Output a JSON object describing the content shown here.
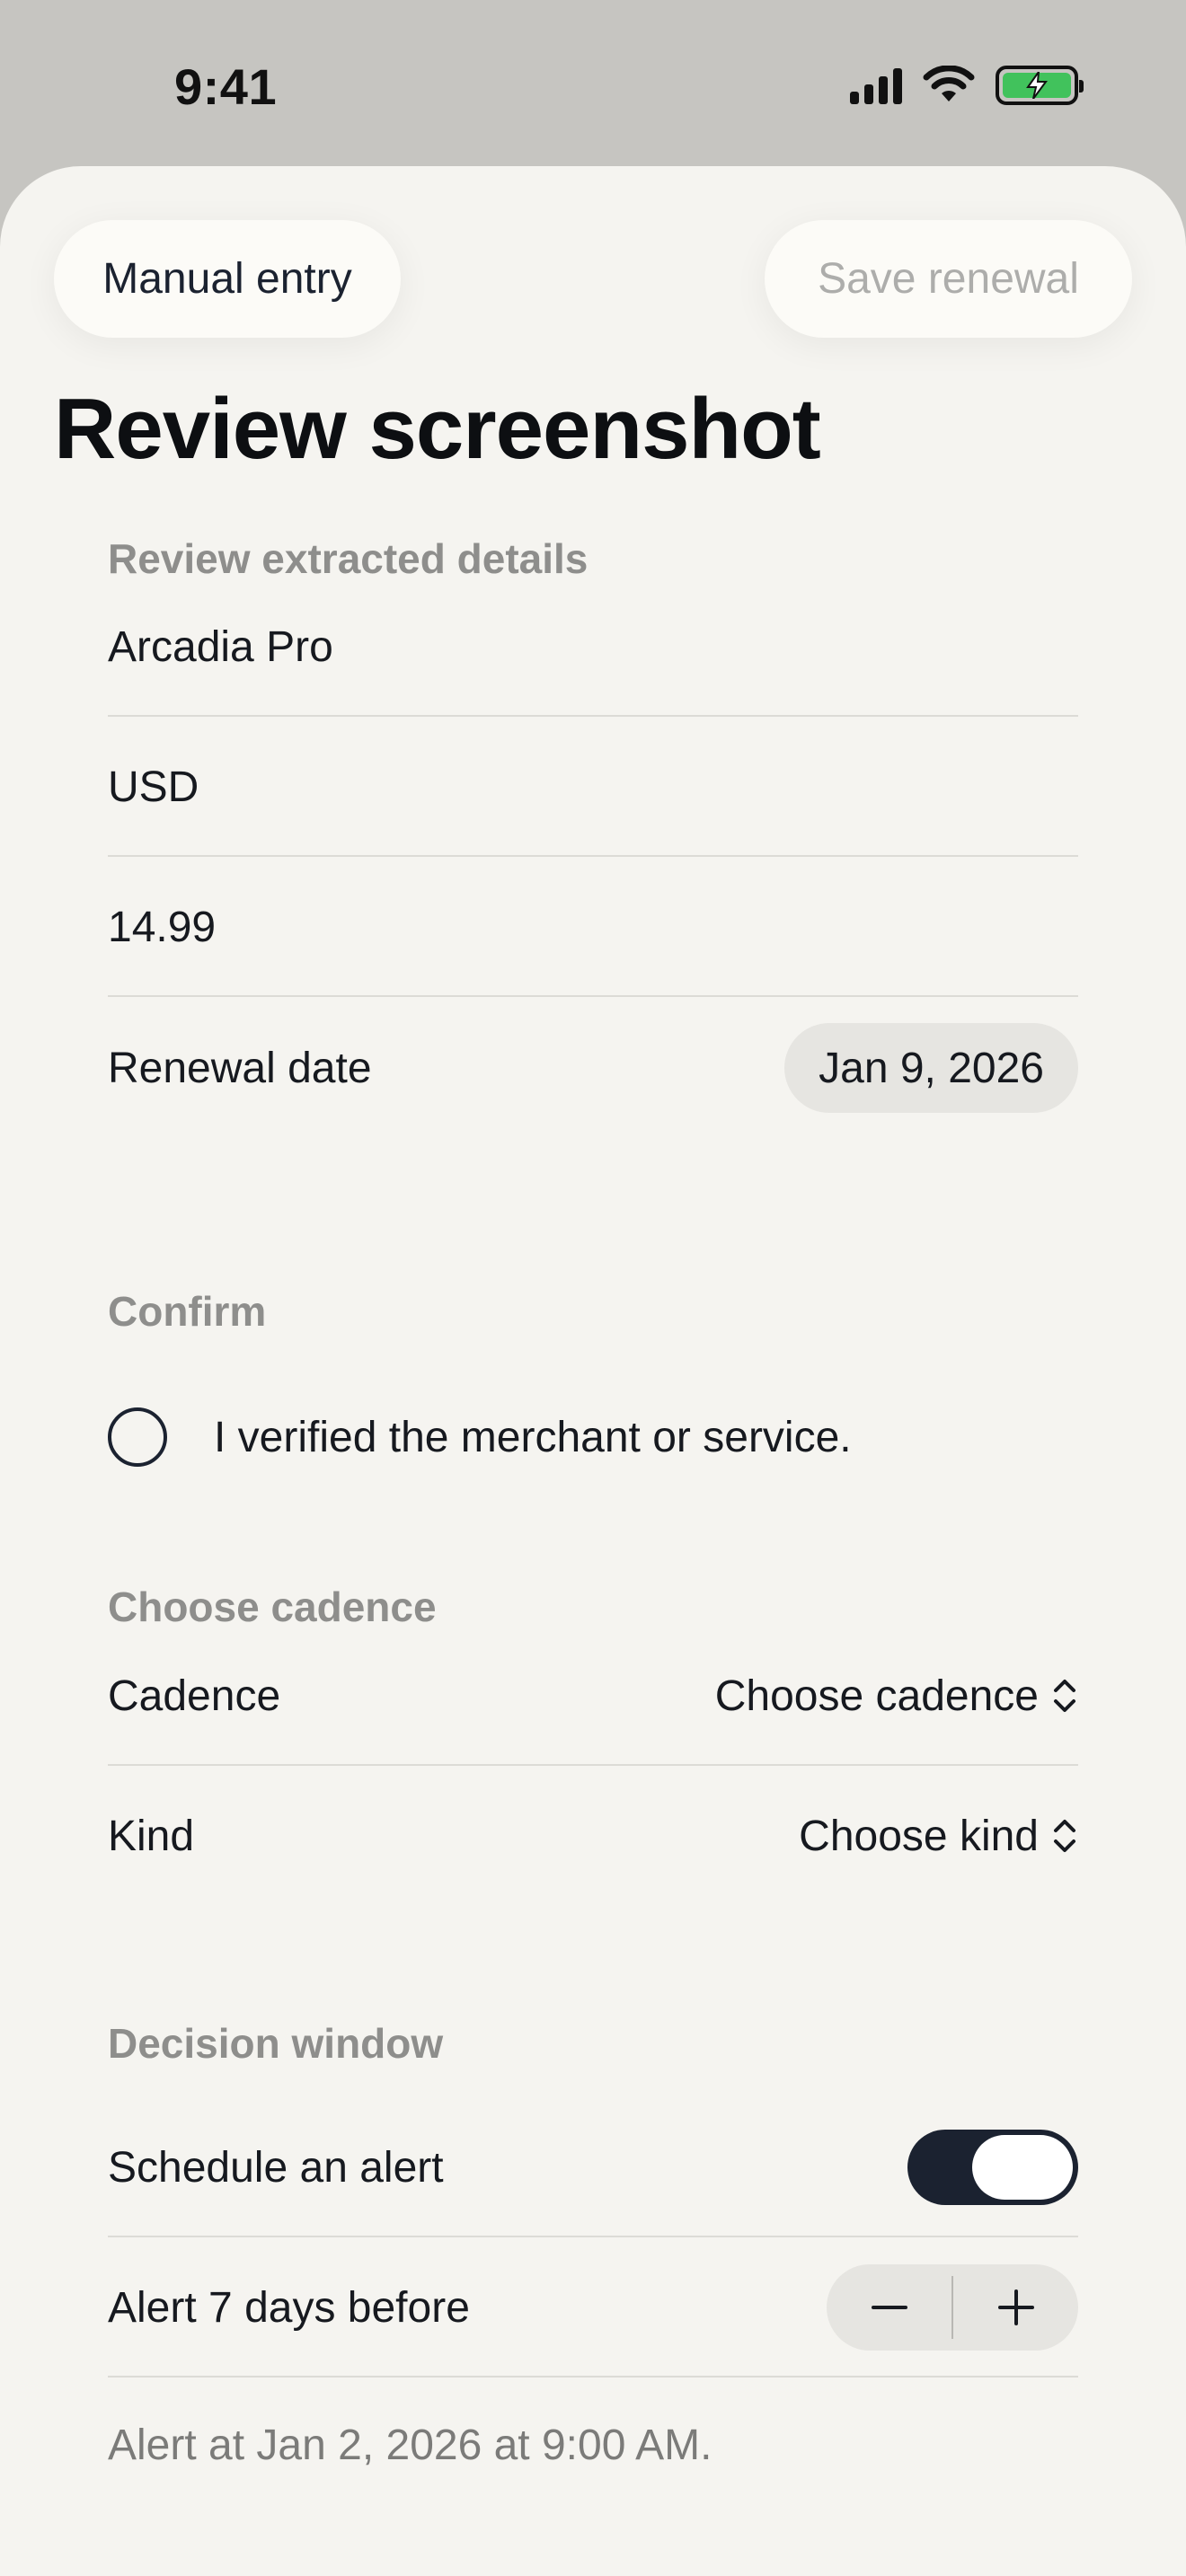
{
  "status_bar": {
    "time": "9:41",
    "icons": [
      "cellular-signal-icon",
      "wifi-icon",
      "battery-charging-icon"
    ],
    "battery_color": "#41c25c"
  },
  "toolbar": {
    "manual_entry_label": "Manual entry",
    "save_label": "Save renewal"
  },
  "page_title": "Review screenshot",
  "extracted": {
    "header": "Review extracted details",
    "name": "Arcadia Pro",
    "currency": "USD",
    "amount": "14.99",
    "renewal_date_label": "Renewal date",
    "renewal_date_value": "Jan 9, 2026"
  },
  "confirm": {
    "header": "Confirm",
    "checkbox_label": "I verified the merchant or service.",
    "checked": false
  },
  "cadence": {
    "header": "Choose cadence",
    "cadence_label": "Cadence",
    "cadence_value": "Choose cadence",
    "kind_label": "Kind",
    "kind_value": "Choose kind"
  },
  "decision": {
    "header": "Decision window",
    "schedule_label": "Schedule an alert",
    "schedule_on": true,
    "alert_label": "Alert 7 days before",
    "footnote": "Alert at Jan 2, 2026 at 9:00 AM."
  },
  "colors": {
    "accent_dark": "#1b2230",
    "sheet_bg": "#f5f4f0",
    "muted_text": "#8e8e8c"
  }
}
